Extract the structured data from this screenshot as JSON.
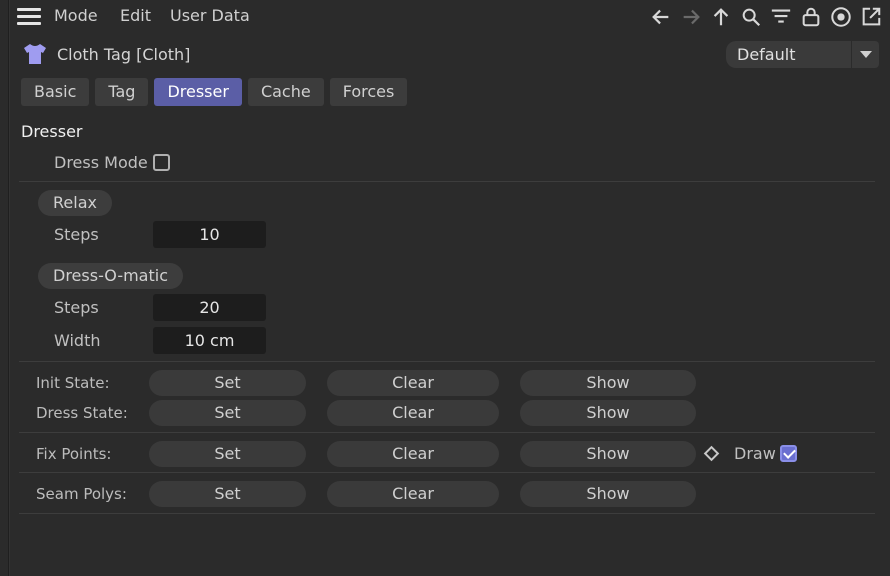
{
  "menu": {
    "mode": "Mode",
    "edit": "Edit",
    "user_data": "User Data"
  },
  "toolbar": {
    "icons": [
      "arrow-left-icon",
      "arrow-right-icon",
      "arrow-up-icon",
      "search-icon",
      "filter-icon",
      "lock-icon",
      "target-icon",
      "new-window-icon"
    ]
  },
  "header": {
    "title": "Cloth Tag [Cloth]",
    "preset": "Default"
  },
  "tabs": [
    {
      "label": "Basic",
      "active": false
    },
    {
      "label": "Tag",
      "active": false
    },
    {
      "label": "Dresser",
      "active": true
    },
    {
      "label": "Cache",
      "active": false
    },
    {
      "label": "Forces",
      "active": false
    }
  ],
  "section": {
    "title": "Dresser"
  },
  "dress_mode": {
    "label": "Dress Mode",
    "checked": false
  },
  "relax": {
    "group": "Relax",
    "steps_label": "Steps",
    "steps_value": "10"
  },
  "dressomatic": {
    "group": "Dress-O-matic",
    "steps_label": "Steps",
    "steps_value": "20",
    "width_label": "Width",
    "width_value": "10 cm"
  },
  "states": {
    "init": {
      "label": "Init State:",
      "set": "Set",
      "clear": "Clear",
      "show": "Show"
    },
    "dress": {
      "label": "Dress State:",
      "set": "Set",
      "clear": "Clear",
      "show": "Show"
    },
    "fix": {
      "label": "Fix Points:",
      "set": "Set",
      "clear": "Clear",
      "show": "Show",
      "draw_label": "Draw",
      "draw_checked": true
    },
    "seam": {
      "label": "Seam Polys:",
      "set": "Set",
      "clear": "Clear",
      "show": "Show"
    }
  },
  "colors": {
    "accent": "#5b5ea6",
    "background": "#2b2b2b",
    "field": "#1d1d1d",
    "shirt_icon": "#9f9cf0"
  }
}
